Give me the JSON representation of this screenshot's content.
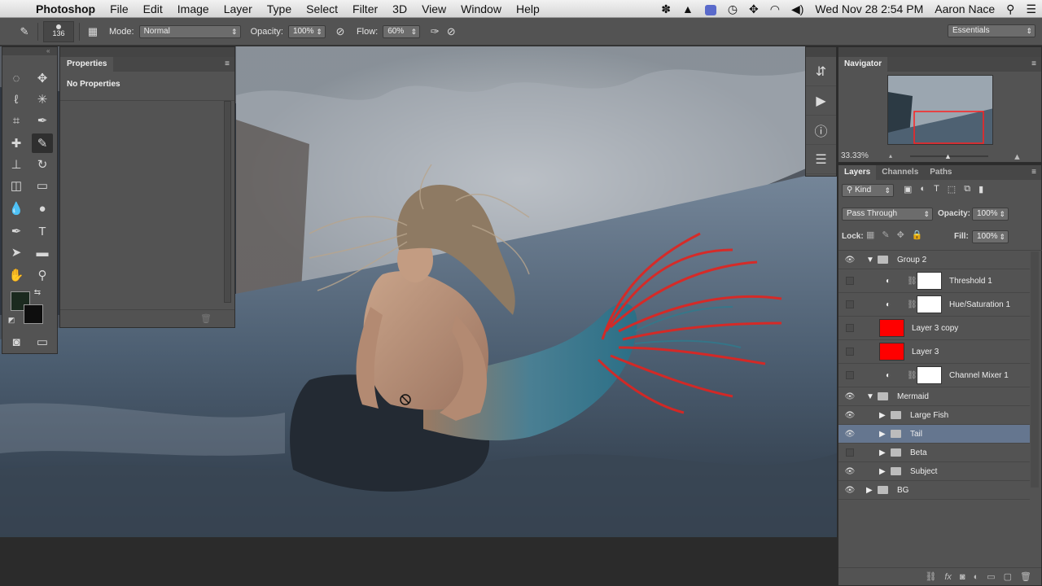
{
  "menubar": {
    "app_name": "Photoshop",
    "items": [
      "File",
      "Edit",
      "Image",
      "Layer",
      "Type",
      "Select",
      "Filter",
      "3D",
      "View",
      "Window",
      "Help"
    ],
    "clock": "Wed Nov 28  2:54 PM",
    "user": "Aaron Nace"
  },
  "options": {
    "brush_size": "136",
    "mode_label": "Mode:",
    "mode_value": "Normal",
    "opacity_label": "Opacity:",
    "opacity_value": "100%",
    "flow_label": "Flow:",
    "flow_value": "60%",
    "workspace": "Essentials"
  },
  "properties": {
    "title": "Properties",
    "message": "No Properties"
  },
  "navigator": {
    "title": "Navigator",
    "zoom": "33.33%"
  },
  "layers_panel": {
    "tabs": [
      "Layers",
      "Channels",
      "Paths"
    ],
    "filter_kind": "Kind",
    "blend_mode": "Pass Through",
    "opacity_label": "Opacity:",
    "opacity_value": "100%",
    "lock_label": "Lock:",
    "fill_label": "Fill:",
    "fill_value": "100%",
    "layers": [
      {
        "name": "Group 2",
        "type": "group",
        "visible": true,
        "expanded": true
      },
      {
        "name": "Threshold 1",
        "type": "adjustment",
        "visible": false
      },
      {
        "name": "Hue/Saturation 1",
        "type": "adjustment",
        "visible": false
      },
      {
        "name": "Layer 3 copy",
        "type": "fill",
        "visible": false
      },
      {
        "name": "Layer 3",
        "type": "fill",
        "visible": false
      },
      {
        "name": "Channel Mixer 1",
        "type": "adjustment",
        "visible": false
      },
      {
        "name": "Mermaid",
        "type": "group",
        "visible": true,
        "expanded": true
      },
      {
        "name": "Large Fish",
        "type": "group",
        "visible": true
      },
      {
        "name": "Tail",
        "type": "group",
        "visible": true,
        "selected": true
      },
      {
        "name": "Beta",
        "type": "group",
        "visible": false
      },
      {
        "name": "Subject",
        "type": "group",
        "visible": true
      },
      {
        "name": "BG",
        "type": "group",
        "visible": true
      }
    ]
  },
  "colors": {
    "panel": "#535353",
    "selected_layer": "#65768f",
    "fill_red": "#ff0000",
    "nav_viewbox": "#ff2020"
  }
}
